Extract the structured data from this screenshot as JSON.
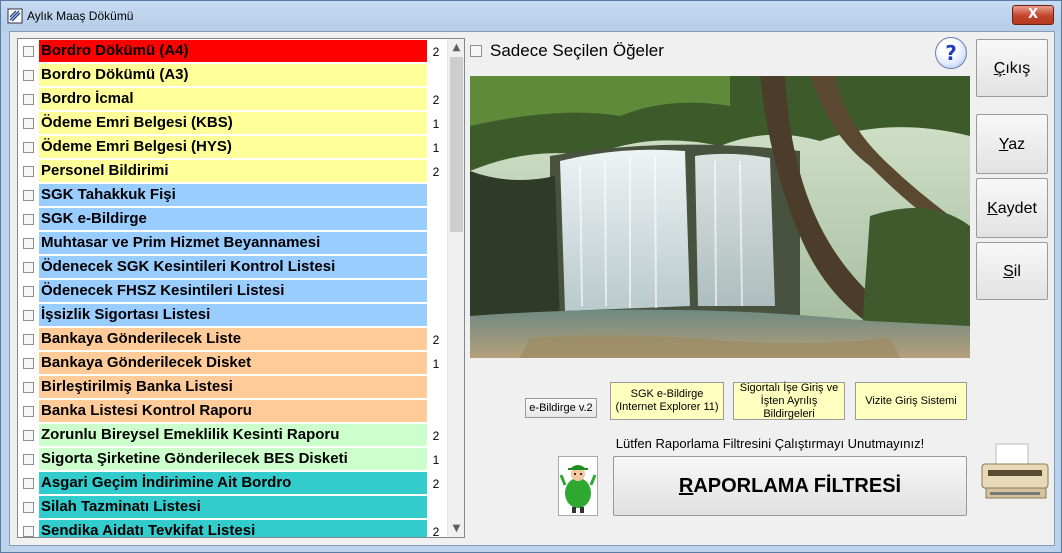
{
  "window": {
    "title": "Aylık Maaş  Dökümü",
    "close_label": "X"
  },
  "list": {
    "items": [
      {
        "label": "Bordro Dökümü (A4)",
        "count": "2",
        "bg": "#ff0000"
      },
      {
        "label": "Bordro Dökümü (A3)",
        "count": "",
        "bg": "#ffff99"
      },
      {
        "label": "Bordro İcmal",
        "count": "2",
        "bg": "#ffff99"
      },
      {
        "label": "Ödeme Emri Belgesi (KBS)",
        "count": "1",
        "bg": "#ffff99"
      },
      {
        "label": "Ödeme Emri Belgesi (HYS)",
        "count": "1",
        "bg": "#ffff99"
      },
      {
        "label": "Personel Bildirimi",
        "count": "2",
        "bg": "#ffff99"
      },
      {
        "label": "SGK Tahakkuk Fişi",
        "count": "",
        "bg": "#99ccff"
      },
      {
        "label": "SGK e-Bildirge",
        "count": "",
        "bg": "#99ccff"
      },
      {
        "label": "Muhtasar ve Prim Hizmet Beyannamesi",
        "count": "",
        "bg": "#99ccff"
      },
      {
        "label": "Ödenecek SGK Kesintileri Kontrol Listesi",
        "count": "",
        "bg": "#99ccff"
      },
      {
        "label": "Ödenecek FHSZ Kesintileri Listesi",
        "count": "",
        "bg": "#99ccff"
      },
      {
        "label": "İşsizlik Sigortası Listesi",
        "count": "",
        "bg": "#99ccff"
      },
      {
        "label": "Bankaya Gönderilecek Liste",
        "count": "2",
        "bg": "#ffcc99"
      },
      {
        "label": "Bankaya Gönderilecek Disket",
        "count": "1",
        "bg": "#ffcc99"
      },
      {
        "label": "Birleştirilmiş Banka Listesi",
        "count": "",
        "bg": "#ffcc99"
      },
      {
        "label": "Banka Listesi Kontrol Raporu",
        "count": "",
        "bg": "#ffcc99"
      },
      {
        "label": "Zorunlu Bireysel Emeklilik Kesinti Raporu",
        "count": "2",
        "bg": "#ccffcc"
      },
      {
        "label": "Sigorta Şirketine Gönderilecek BES Disketi",
        "count": "1",
        "bg": "#ccffcc"
      },
      {
        "label": "Asgari Geçim İndirimine Ait Bordro",
        "count": "2",
        "bg": "#33cccc"
      },
      {
        "label": "Silah Tazminatı Listesi",
        "count": "",
        "bg": "#33cccc"
      },
      {
        "label": "Sendika Aidatı Tevkifat Listesi",
        "count": "2",
        "bg": "#33cccc"
      }
    ]
  },
  "only_selected_label": "Sadece Seçilen Öğeler",
  "help_label": "?",
  "side_buttons": {
    "exit": {
      "label_u": "Ç",
      "label_rest": "ıkış"
    },
    "print": {
      "label_u": "Y",
      "label_rest": "az"
    },
    "save": {
      "label_u": "K",
      "label_rest": "aydet"
    },
    "delete": {
      "label_u": "S",
      "label_rest": "il"
    }
  },
  "small_buttons": {
    "ebildirge_v2": "e-Bildirge v.2",
    "sgk_ebildirge": "SGK e-Bildirge (Internet Explorer 11)",
    "sigortali": "Sigortalı İşe Giriş ve İşten Ayrılış Bildirgeleri",
    "vizite": "Vizite Giriş Sistemi"
  },
  "reminder": "Lütfen Raporlama Filtresini Çalıştırmayı Unutmayınız!",
  "report_button": {
    "label_u": "R",
    "label_rest": "APORLAMA FİLTRESİ"
  },
  "colors": {
    "yellow_btn": "#ffffc0",
    "accent": "#ff0000"
  }
}
